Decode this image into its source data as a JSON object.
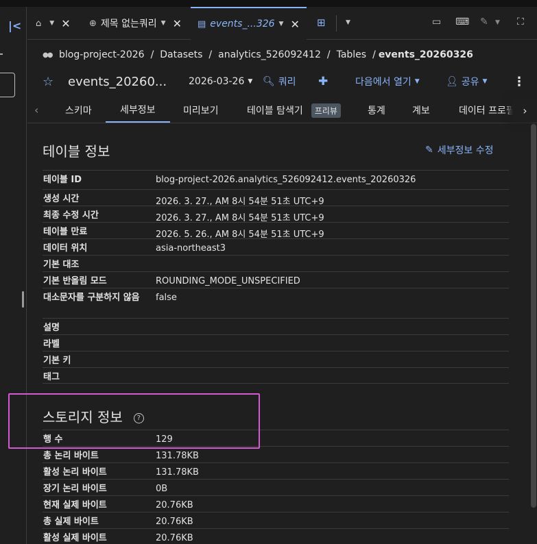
{
  "tabs": [
    {
      "label": "",
      "icon": "home-icon"
    },
    {
      "label": "제목 없는쿼리",
      "icon": "query-icon"
    },
    {
      "label": "events_...326",
      "icon": "table-icon"
    }
  ],
  "breadcrumb": [
    "blog-project-2026",
    "Datasets",
    "analytics_526092412",
    "Tables",
    "events_20260326"
  ],
  "header": {
    "title": "events_20260...",
    "date": "2026-03-26",
    "query_label": "쿼리",
    "open_in_label": "다음에서 열기",
    "share_label": "공유"
  },
  "subtabs": [
    "스키마",
    "세부정보",
    "미리보기",
    "테이블 탐색기",
    "통계",
    "계보",
    "데이터 프로필"
  ],
  "subtab_badge": "프리뷰",
  "table_info": {
    "title": "테이블 정보",
    "edit_label": "세부정보 수정",
    "rows": [
      {
        "key": "테이블 ID",
        "value": "blog-project-2026.analytics_526092412.events_20260326"
      },
      {
        "key": "생성 시간",
        "value": "2026. 3. 27., AM 8시 54분 51초 UTC+9"
      },
      {
        "key": "최종 수정 시간",
        "value": "2026. 3. 27., AM 8시 54분 51초 UTC+9"
      },
      {
        "key": "테이블 만료",
        "value": "2026. 5. 26., AM 8시 54분 51초 UTC+9"
      },
      {
        "key": "데이터 위치",
        "value": "asia-northeast3"
      },
      {
        "key": "기본 대조",
        "value": ""
      },
      {
        "key": "기본 반올림 모드",
        "value": "ROUNDING_MODE_UNSPECIFIED"
      },
      {
        "key": "대소문자를 구분하지 않음",
        "value": "false"
      },
      {
        "key": "설명",
        "value": ""
      },
      {
        "key": "라벨",
        "value": ""
      },
      {
        "key": "기본 키",
        "value": ""
      },
      {
        "key": "태그",
        "value": ""
      }
    ]
  },
  "storage_info": {
    "title": "스토리지 정보",
    "rows": [
      {
        "key": "행 수",
        "value": "129"
      },
      {
        "key": "총 논리 바이트",
        "value": "131.78KB"
      },
      {
        "key": "활성 논리 바이트",
        "value": "131.78KB"
      },
      {
        "key": "장기 논리 바이트",
        "value": "0B"
      },
      {
        "key": "현재 실제 바이트",
        "value": "20.76KB"
      },
      {
        "key": "총 실제 바이트",
        "value": "20.76KB"
      },
      {
        "key": "활성 실제 바이트",
        "value": "20.76KB"
      }
    ]
  },
  "colors": {
    "accent": "#8ab4f8",
    "highlight": "#d35ad0",
    "background": "#1f1f1f"
  }
}
